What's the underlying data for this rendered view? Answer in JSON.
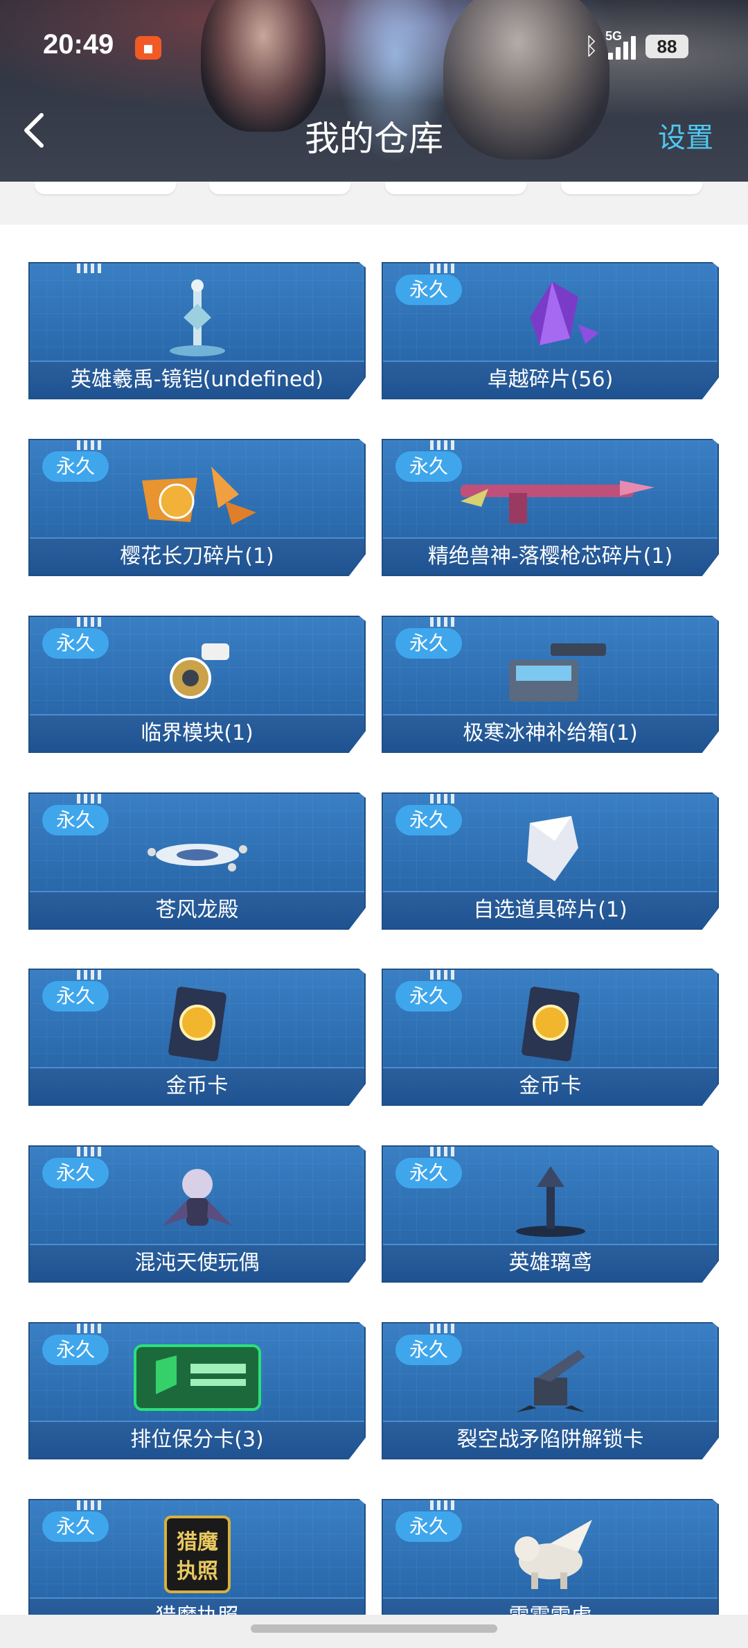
{
  "status_bar": {
    "time": "20:49",
    "network": "5G",
    "battery": "88"
  },
  "header": {
    "title": "我的仓库",
    "settings": "设置"
  },
  "items": [
    {
      "tag": "",
      "name": "英雄羲禹-镜铠(undefined)",
      "icon": "hero-statue-icon"
    },
    {
      "tag": "永久",
      "name": "卓越碎片(56)",
      "icon": "purple-crystal-icon"
    },
    {
      "tag": "永久",
      "name": "樱花长刀碎片(1)",
      "icon": "gold-shards-icon"
    },
    {
      "tag": "永久",
      "name": "精绝兽神-落樱枪芯碎片(1)",
      "icon": "pink-rifle-icon"
    },
    {
      "tag": "永久",
      "name": "临界模块(1)",
      "icon": "module-device-icon"
    },
    {
      "tag": "永久",
      "name": "极寒冰神补给箱(1)",
      "icon": "supply-crate-icon"
    },
    {
      "tag": "永久",
      "name": "苍风龙殿",
      "icon": "dragon-ship-icon"
    },
    {
      "tag": "永久",
      "name": "自选道具碎片(1)",
      "icon": "silver-fragment-icon"
    },
    {
      "tag": "永久",
      "name": "金币卡",
      "icon": "gold-coin-card-icon"
    },
    {
      "tag": "永久",
      "name": "金币卡",
      "icon": "gold-coin-card-icon"
    },
    {
      "tag": "永久",
      "name": "混沌天使玩偶",
      "icon": "angel-doll-icon"
    },
    {
      "tag": "永久",
      "name": "英雄璃鸢",
      "icon": "hero-figure-icon"
    },
    {
      "tag": "永久",
      "name": "排位保分卡(3)",
      "icon": "rank-protect-card-icon"
    },
    {
      "tag": "永久",
      "name": "裂空战矛陷阱解锁卡",
      "icon": "turret-trap-icon"
    },
    {
      "tag": "永久",
      "name": "猎魔执照",
      "icon": "hunter-license-icon",
      "icon_text": [
        "猎魔",
        "执照"
      ]
    },
    {
      "tag": "永久",
      "name": "雪霜雪虎",
      "icon": "white-tiger-icon"
    }
  ],
  "colors": {
    "accent": "#4fc8f0",
    "card": "#2f72b6",
    "tag": "#3fa6ec"
  }
}
